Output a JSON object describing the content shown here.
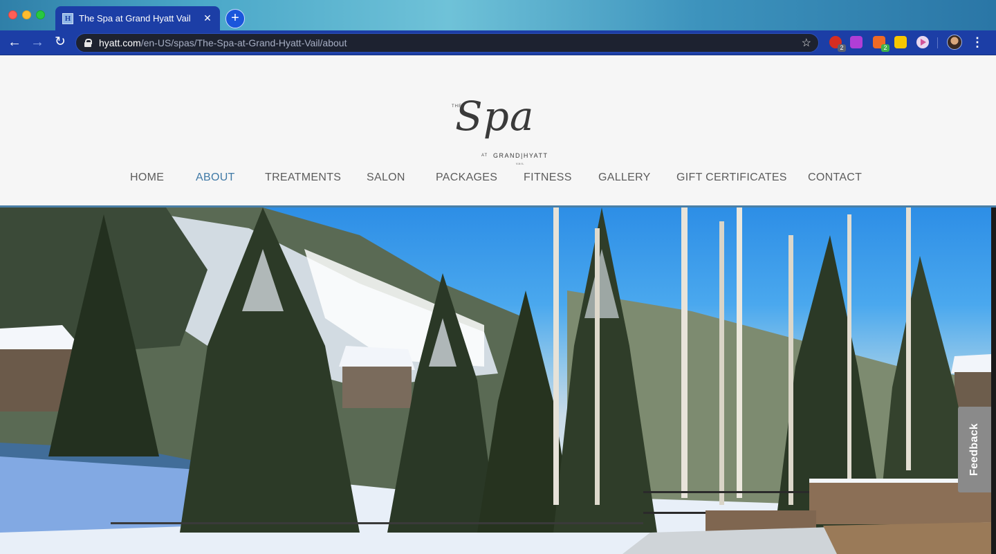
{
  "browser": {
    "tab": {
      "title": "The Spa at Grand Hyatt Vail",
      "favicon_letter": "H"
    },
    "address": {
      "domain": "hyatt.com",
      "path": "/en-US/spas/The-Spa-at-Grand-Hyatt-Vail/about"
    },
    "extensions": [
      {
        "name": "extension-1",
        "badge": "2"
      },
      {
        "name": "extension-2",
        "badge": ""
      },
      {
        "name": "extension-3",
        "badge": "2"
      },
      {
        "name": "extension-4",
        "badge": ""
      },
      {
        "name": "extension-5",
        "badge": ""
      }
    ],
    "colors": {
      "chrome": "#1c3ea6",
      "omnibox": "#1d2230"
    }
  },
  "site": {
    "logo": {
      "the": "THE",
      "spa": "Spa",
      "at": "AT",
      "grand_hyatt": "GRAND|HYATT",
      "vail": "VAIL"
    },
    "nav": [
      {
        "label": "HOME"
      },
      {
        "label": "ABOUT",
        "active": true
      },
      {
        "label": "TREATMENTS"
      },
      {
        "label": "SALON"
      },
      {
        "label": "PACKAGES"
      },
      {
        "label": "FITNESS"
      },
      {
        "label": "GALLERY"
      },
      {
        "label": "GIFT CERTIFICATES"
      },
      {
        "label": "CONTACT"
      }
    ],
    "colors": {
      "active_nav": "#3f79a6",
      "nav_text": "#5c5c5c",
      "rule": "#4a7fa6"
    }
  },
  "feedback": {
    "label": "Feedback"
  }
}
